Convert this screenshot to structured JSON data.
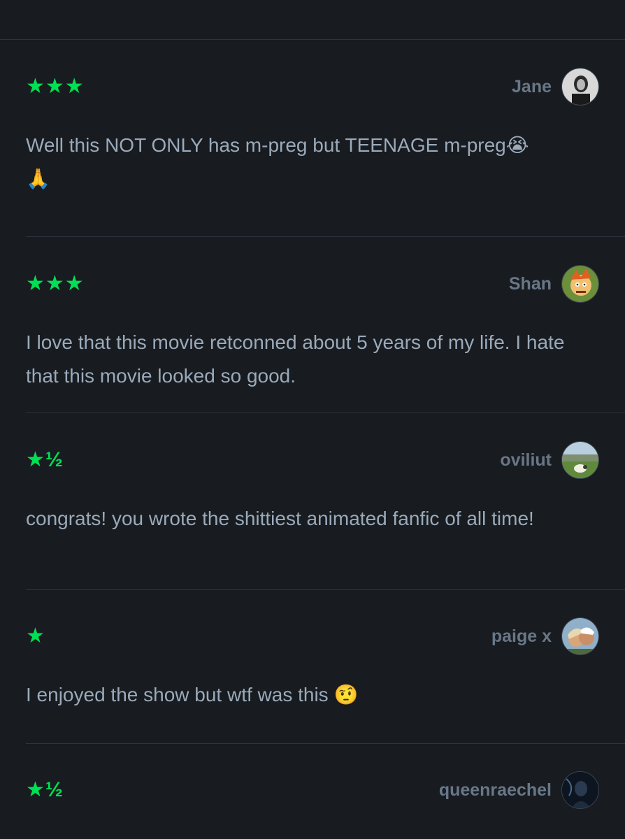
{
  "reviews": [
    {
      "rating": "★★★",
      "author": "Jane",
      "text": "Well this NOT ONLY has m-preg but TEENAGE m-preg",
      "emojis": [
        "😭",
        "🙏"
      ]
    },
    {
      "rating": "★★★",
      "author": "Shan",
      "text": "I love that this movie retconned about 5 years of my life. I hate that this movie looked so good.",
      "emojis": []
    },
    {
      "rating": "★½",
      "author": "oviliut",
      "text": "congrats! you wrote the shittiest animated fanfic of all time!",
      "emojis": []
    },
    {
      "rating": "★",
      "author": "paige x",
      "text": "I enjoyed the show but wtf was this",
      "emojis": [
        "🤨"
      ]
    },
    {
      "rating": "★½",
      "author": "queenraechel",
      "text": "",
      "emojis": []
    }
  ],
  "colors": {
    "background": "#181b1f",
    "star_green": "#00e054",
    "author_text": "#687788",
    "body_text": "#9aaabb",
    "divider": "#2c3440"
  }
}
